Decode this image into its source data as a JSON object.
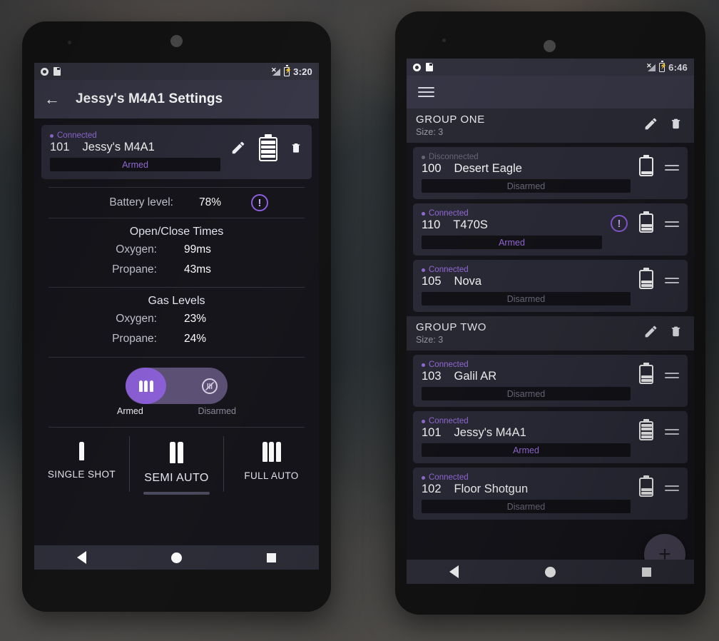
{
  "left_phone": {
    "status_bar": {
      "clock": "3:20",
      "icons": [
        "record-icon",
        "sd-card-icon",
        "signal-icon",
        "battery-charging-icon"
      ]
    },
    "appbar": {
      "back_label": "←",
      "title": "Jessy's M4A1 Settings"
    },
    "device_card": {
      "connection": "Connected",
      "id": "101",
      "name": "Jessy's M4A1",
      "arm_state": "Armed",
      "battery_segments": 4,
      "actions": [
        "edit-pencil-icon",
        "battery-icon",
        "delete-trash-icon"
      ]
    },
    "battery_row": {
      "label": "Battery level:",
      "value": "78%",
      "warning": "!"
    },
    "open_close": {
      "title": "Open/Close Times",
      "rows": [
        {
          "label": "Oxygen:",
          "value": "99ms"
        },
        {
          "label": "Propane:",
          "value": "43ms"
        }
      ]
    },
    "gas_levels": {
      "title": "Gas Levels",
      "rows": [
        {
          "label": "Oxygen:",
          "value": "23%"
        },
        {
          "label": "Propane:",
          "value": "24%"
        }
      ]
    },
    "arm_toggle": {
      "on_label": "Armed",
      "off_label": "Disarmed",
      "state": "Armed"
    },
    "fire_modes": [
      {
        "label": "SINGLE SHOT",
        "bullets": 1,
        "active": false
      },
      {
        "label": "SEMI AUTO",
        "bullets": 2,
        "active": true
      },
      {
        "label": "FULL AUTO",
        "bullets": 3,
        "active": false
      }
    ],
    "nav": [
      "back",
      "home",
      "recents"
    ]
  },
  "right_phone": {
    "status_bar": {
      "clock": "6:46",
      "icons": [
        "record-icon",
        "sd-card-icon",
        "signal-icon",
        "battery-charging-icon"
      ]
    },
    "appbar": {
      "menu": "hamburger-menu-icon"
    },
    "groups": [
      {
        "name": "GROUP ONE",
        "size_label": "Size: 3",
        "devices": [
          {
            "connection": "Disconnected",
            "connected": false,
            "id": "100",
            "name": "Desert Eagle",
            "arm_state": "Disarmed",
            "armed": false,
            "battery_segments": 1,
            "warning": false
          },
          {
            "connection": "Connected",
            "connected": true,
            "id": "110",
            "name": "T470S",
            "arm_state": "Armed",
            "armed": true,
            "battery_segments": 2,
            "warning": true
          },
          {
            "connection": "Connected",
            "connected": true,
            "id": "105",
            "name": "Nova",
            "arm_state": "Disarmed",
            "armed": false,
            "battery_segments": 2,
            "warning": false
          }
        ]
      },
      {
        "name": "GROUP TWO",
        "size_label": "Size: 3",
        "devices": [
          {
            "connection": "Connected",
            "connected": true,
            "id": "103",
            "name": "Galil AR",
            "arm_state": "Disarmed",
            "armed": false,
            "battery_segments": 2,
            "warning": false
          },
          {
            "connection": "Connected",
            "connected": true,
            "id": "101",
            "name": "Jessy's M4A1",
            "arm_state": "Armed",
            "armed": true,
            "battery_segments": 4,
            "warning": false
          },
          {
            "connection": "Connected",
            "connected": true,
            "id": "102",
            "name": "Floor Shotgun",
            "arm_state": "Disarmed",
            "armed": false,
            "battery_segments": 2,
            "warning": false
          }
        ]
      }
    ],
    "fab": {
      "label": "+"
    },
    "nav": [
      "back",
      "home",
      "recents"
    ]
  },
  "colors": {
    "accent_purple": "#9a6fe0",
    "appbar": "#373747",
    "card": "#2c2c3a",
    "screen_bg": "#15151b",
    "status_bar": "#32323f"
  }
}
